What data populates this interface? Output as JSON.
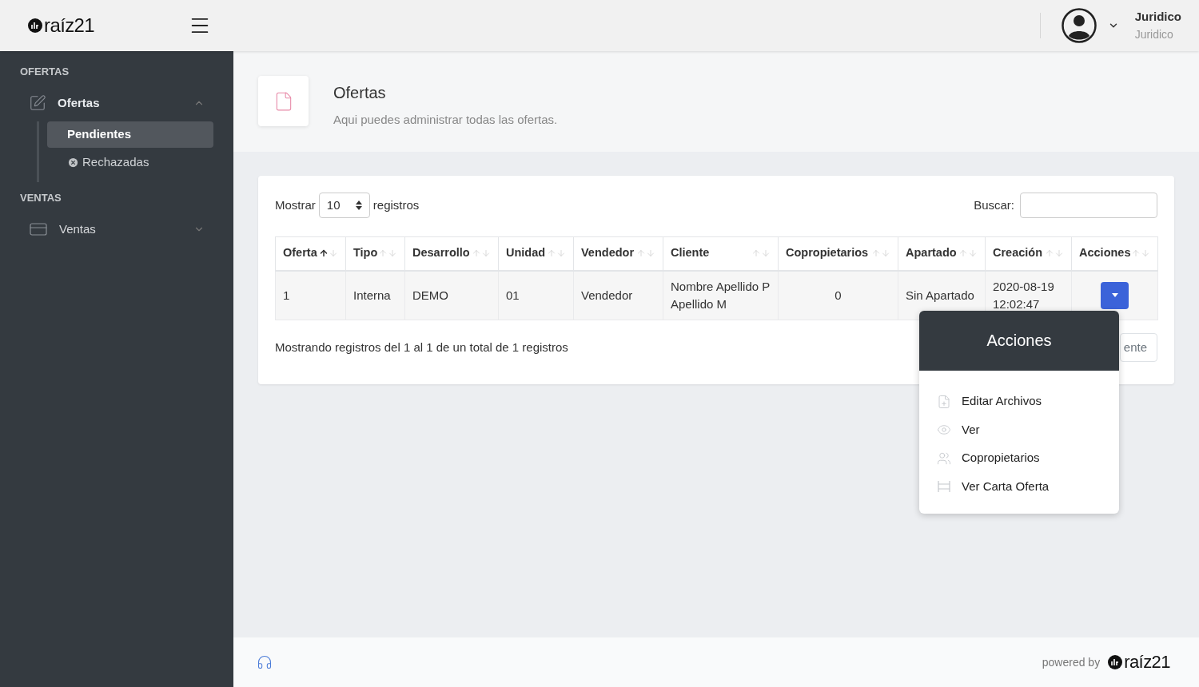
{
  "brand": {
    "logo_text": "raíz21"
  },
  "user": {
    "name": "Juridico",
    "role": "Juridico"
  },
  "sidebar": {
    "sections": [
      {
        "title": "OFERTAS",
        "items": [
          {
            "label": "Ofertas",
            "expanded": true,
            "children": [
              {
                "label": "Pendientes",
                "selected": true
              },
              {
                "label": "Rechazadas",
                "selected": false
              }
            ]
          }
        ]
      },
      {
        "title": "VENTAS",
        "items": [
          {
            "label": "Ventas",
            "expanded": false
          }
        ]
      }
    ]
  },
  "page_header": {
    "title": "Ofertas",
    "subtitle": "Aqui puedes administrar todas las ofertas."
  },
  "table_controls": {
    "show_label": "Mostrar",
    "page_size": "10",
    "records_label": "registros",
    "search_label": "Buscar:"
  },
  "table": {
    "columns": [
      {
        "label": "Oferta",
        "sorted": true
      },
      {
        "label": "Tipo",
        "sorted": false
      },
      {
        "label": "Desarrollo",
        "sorted": false
      },
      {
        "label": "Unidad",
        "sorted": false
      },
      {
        "label": "Vendedor",
        "sorted": false
      },
      {
        "label": "Cliente",
        "sorted": false
      },
      {
        "label": "Copropietarios",
        "sorted": false
      },
      {
        "label": "Apartado",
        "sorted": false
      },
      {
        "label": "Creación",
        "sorted": false
      },
      {
        "label": "Acciones",
        "sorted": false
      }
    ],
    "rows": [
      {
        "cells": [
          "1",
          "Interna",
          "DEMO",
          "01",
          "Vendedor",
          "Nombre Apellido P Apellido M",
          "0",
          "Sin Apartado",
          "2020-08-19 12:02:47"
        ]
      }
    ]
  },
  "info": "Mostrando registros del 1 al 1 de un total de 1 registros",
  "pagination": {
    "next_label": "ente"
  },
  "actions_menu": {
    "title": "Acciones",
    "items": [
      {
        "label": "Editar Archivos"
      },
      {
        "label": "Ver"
      },
      {
        "label": "Copropietarios"
      },
      {
        "label": "Ver Carta Oferta"
      }
    ]
  },
  "footer": {
    "powered_by": "powered by",
    "logo_text": "raíz21"
  }
}
